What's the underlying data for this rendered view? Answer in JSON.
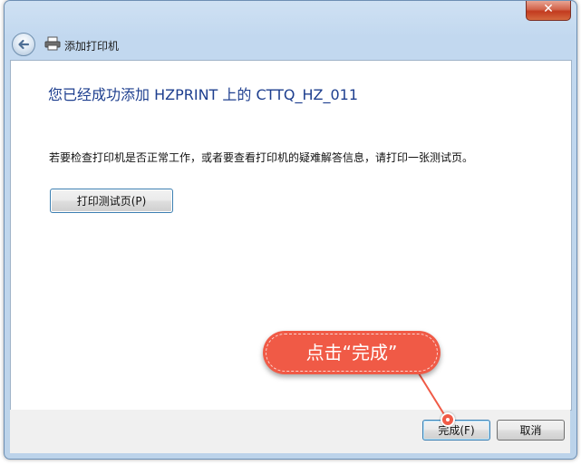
{
  "window": {
    "title": "添加打印机",
    "close_glyph": "✕"
  },
  "content": {
    "heading": "您已经成功添加 HZPRINT 上的 CTTQ_HZ_011",
    "info": "若要检查打印机是否正常工作，或者要查看打印机的疑难解答信息，请打印一张测试页。",
    "test_button": "打印测试页(P)"
  },
  "footer": {
    "finish_button": "完成(F)",
    "cancel_button": "取消"
  },
  "annotation": {
    "callout_text": "点击“完成”",
    "color": "#f05a46"
  },
  "icons": {
    "back": "back-arrow-icon",
    "printer": "printer-icon",
    "close": "close-icon"
  }
}
